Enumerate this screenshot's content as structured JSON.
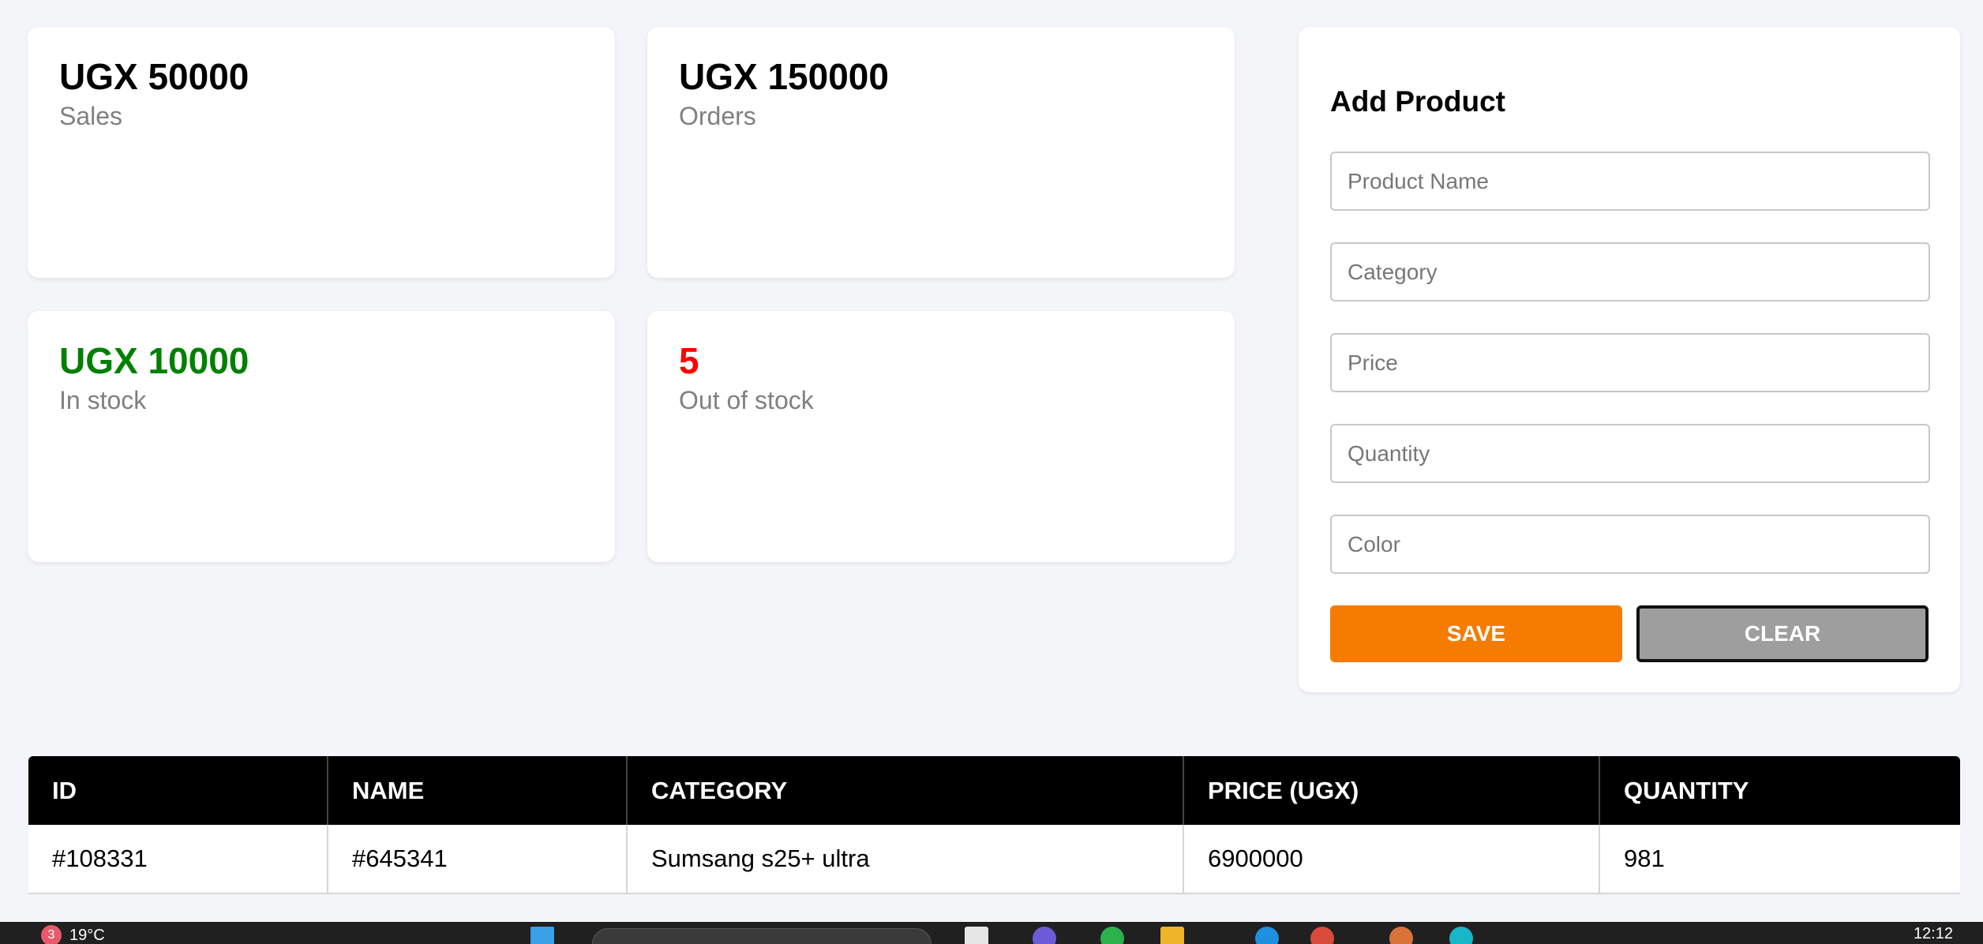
{
  "stats": [
    {
      "value": "UGX 50000",
      "label": "Sales",
      "color": "#000000"
    },
    {
      "value": "UGX 150000",
      "label": "Orders",
      "color": "#000000"
    },
    {
      "value": "UGX 10000",
      "label": "In stock",
      "color": "#008000"
    },
    {
      "value": "5",
      "label": "Out of stock",
      "color": "#ff0000"
    }
  ],
  "form": {
    "title": "Add Product",
    "fields": {
      "name": {
        "placeholder": "Product Name"
      },
      "category": {
        "placeholder": "Category"
      },
      "price": {
        "placeholder": "Price"
      },
      "quantity": {
        "placeholder": "Quantity"
      },
      "color": {
        "placeholder": "Color"
      }
    },
    "save_label": "SAVE",
    "clear_label": "CLEAR",
    "save_color": "#f57c00",
    "clear_color": "#9e9e9e"
  },
  "table": {
    "headers": [
      "ID",
      "NAME",
      "CATEGORY",
      "PRICE (UGX)",
      "QUANTITY"
    ],
    "rows": [
      [
        "#108331",
        "#645341",
        "Sumsang s25+ ultra",
        "6900000",
        "981"
      ]
    ]
  },
  "taskbar": {
    "notification_count": "3",
    "weather": "19°C",
    "clock": "12:12"
  }
}
